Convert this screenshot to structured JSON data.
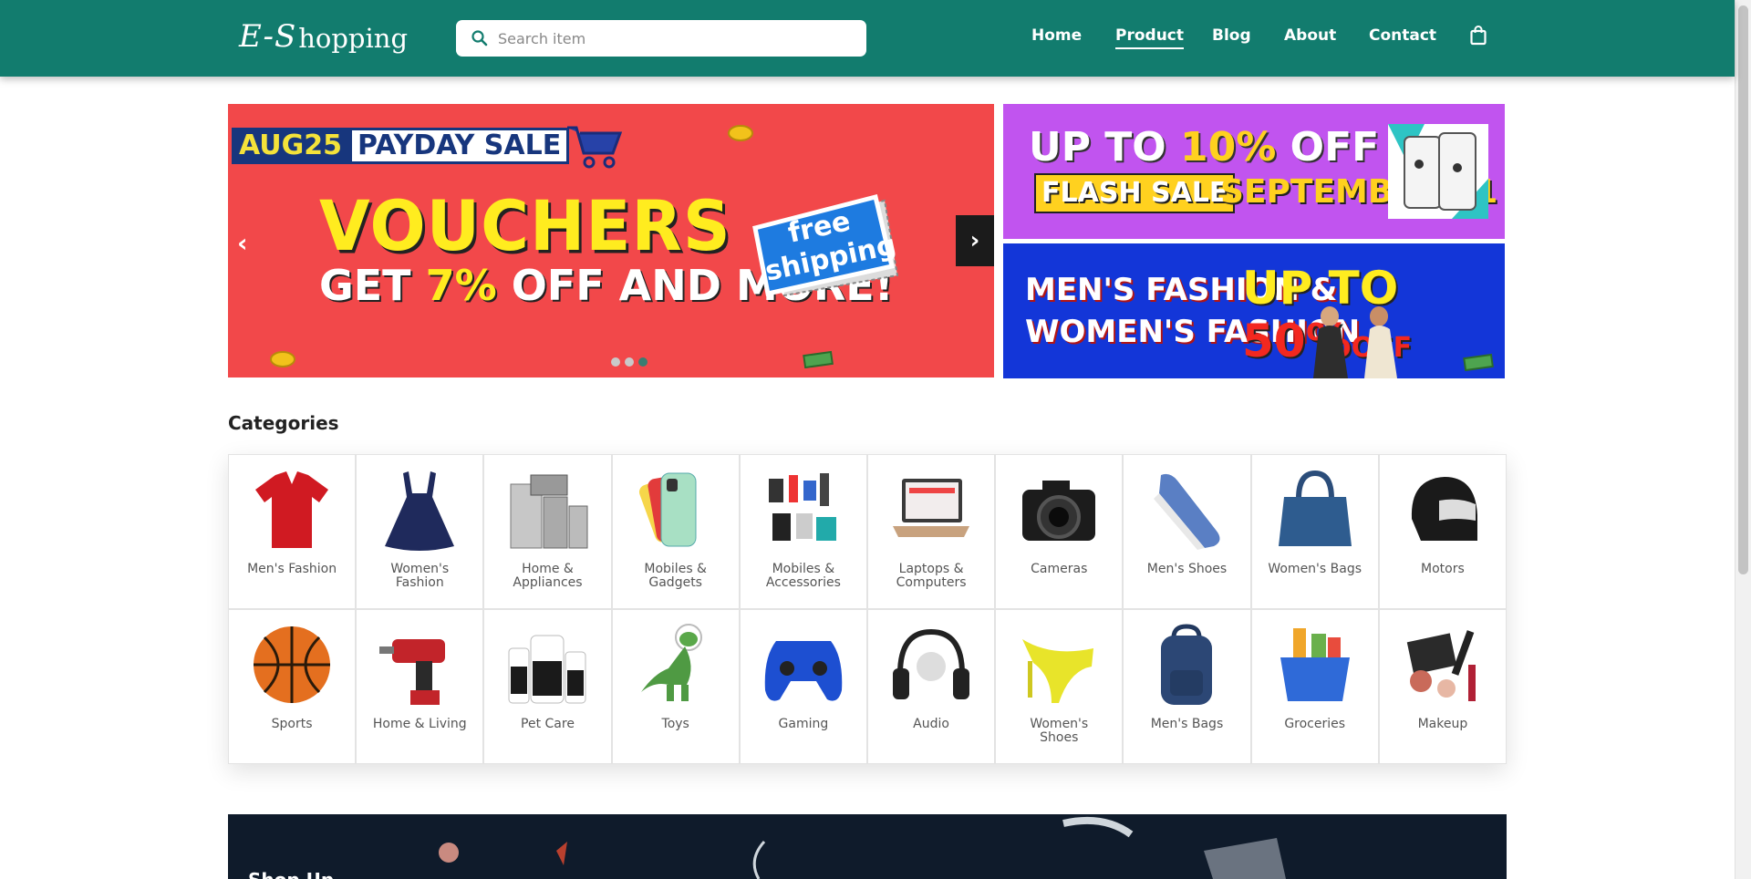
{
  "header": {
    "logo_script": "E-S",
    "logo_rest": "hopping",
    "search_placeholder": "Search item",
    "nav": [
      "Home",
      "Product",
      "Blog",
      "About",
      "Contact"
    ],
    "active_nav": "Product",
    "colors": {
      "navbar": "#127c6e",
      "text": "#ffffff"
    },
    "cart_icon": "shopping-bag-icon"
  },
  "slider": {
    "tag_date": "AUG25",
    "tag_text": "PAYDAY SALE",
    "headline": "VOUCHERS",
    "subline_pre": "GET ",
    "subline_pct": "7%",
    "subline_post": " OFF AND MORE!",
    "badge_line1": "free",
    "badge_line2": "shipping",
    "prev": "‹",
    "next": "›",
    "slides": 3,
    "active_slide": 3,
    "bg_color": "#f2484a"
  },
  "side_banner_1": {
    "top_pre": "UP TO ",
    "top_pct": "10%",
    "top_post": " OFF",
    "flash": "FLASH SALE",
    "date": "SEPTEMBER 01",
    "bg_color": "#c154ef"
  },
  "side_banner_2": {
    "line1": "MEN'S FASHION &",
    "line2": "WOMEN'S FASHION",
    "upto": "UP TO ",
    "pct": "50%",
    "off": "OFF",
    "bg_color": "#1336d8"
  },
  "categories": {
    "title": "Categories",
    "items": [
      {
        "label": "Men's Fashion",
        "icon": "tshirt-icon"
      },
      {
        "label": "Women's Fashion",
        "icon": "dress-icon"
      },
      {
        "label": "Home & Appliances",
        "icon": "appliances-icon"
      },
      {
        "label": "Mobiles & Gadgets",
        "icon": "phone-icon"
      },
      {
        "label": "Mobiles & Accessories",
        "icon": "accessories-icon"
      },
      {
        "label": "Laptops & Computers",
        "icon": "laptop-icon"
      },
      {
        "label": "Cameras",
        "icon": "camera-icon"
      },
      {
        "label": "Men's Shoes",
        "icon": "sneaker-icon"
      },
      {
        "label": "Women's Bags",
        "icon": "handbag-icon"
      },
      {
        "label": "Motors",
        "icon": "helmet-icon"
      },
      {
        "label": "Sports",
        "icon": "basketball-icon"
      },
      {
        "label": "Home & Living",
        "icon": "drill-icon"
      },
      {
        "label": "Pet Care",
        "icon": "pet-bottles-icon"
      },
      {
        "label": "Toys",
        "icon": "toy-dinosaur-icon"
      },
      {
        "label": "Gaming",
        "icon": "gamepad-icon"
      },
      {
        "label": "Audio",
        "icon": "headphones-icon"
      },
      {
        "label": "Women's Shoes",
        "icon": "heels-icon"
      },
      {
        "label": "Men's Bags",
        "icon": "backpack-icon"
      },
      {
        "label": "Groceries",
        "icon": "grocery-basket-icon"
      },
      {
        "label": "Makeup",
        "icon": "makeup-icon"
      }
    ]
  },
  "promo_strip": {
    "text": "Shop Up",
    "bg_color": "#0f1b2b"
  }
}
